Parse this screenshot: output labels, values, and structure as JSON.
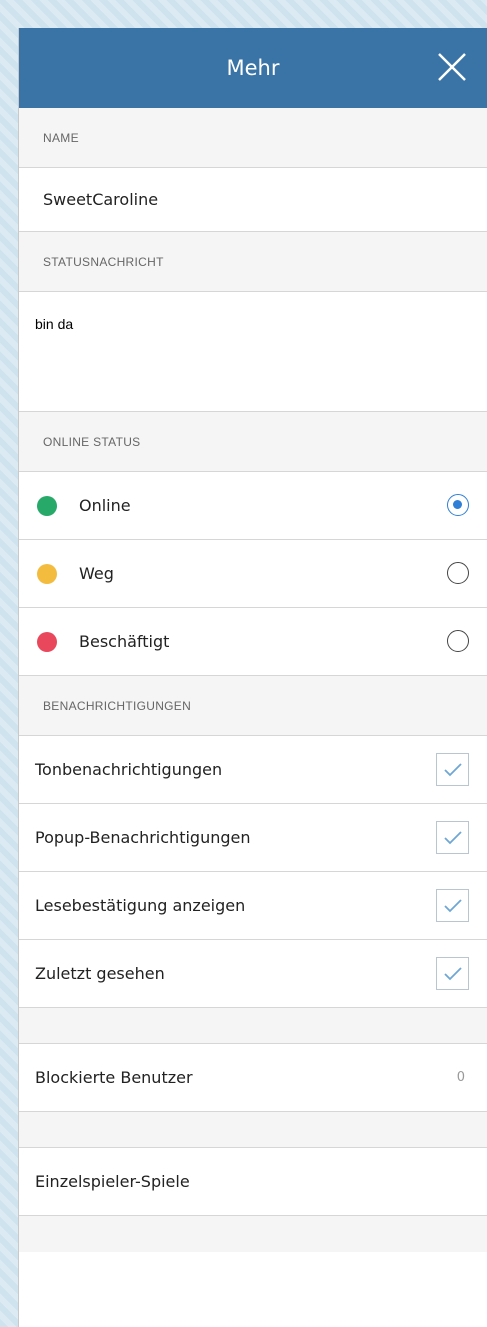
{
  "header": {
    "title": "Mehr",
    "close_icon": "close-icon"
  },
  "name_section": {
    "label": "NAME",
    "value": "SweetCaroline"
  },
  "status_section": {
    "label": "STATUSNACHRICHT",
    "value": "bin da"
  },
  "online_section": {
    "label": "ONLINE STATUS",
    "options": [
      {
        "label": "Online",
        "color": "#27a96a",
        "selected": true
      },
      {
        "label": "Weg",
        "color": "#f3bc3e",
        "selected": false
      },
      {
        "label": "Beschäftigt",
        "color": "#e9475b",
        "selected": false
      }
    ]
  },
  "notifications_section": {
    "label": "BENACHRICHTIGUNGEN",
    "items": [
      {
        "label": "Tonbenachrichtigungen",
        "checked": true
      },
      {
        "label": "Popup-Benachrichtigungen",
        "checked": true
      },
      {
        "label": "Lesebestätigung anzeigen",
        "checked": true
      },
      {
        "label": "Zuletzt gesehen",
        "checked": true
      }
    ]
  },
  "blocked": {
    "label": "Blockierte Benutzer",
    "count": "0"
  },
  "games": {
    "label": "Einzelspieler-Spiele"
  },
  "colors": {
    "header_bg": "#3a74a6",
    "accent": "#2f7fd6",
    "check": "#6fa6d6"
  }
}
